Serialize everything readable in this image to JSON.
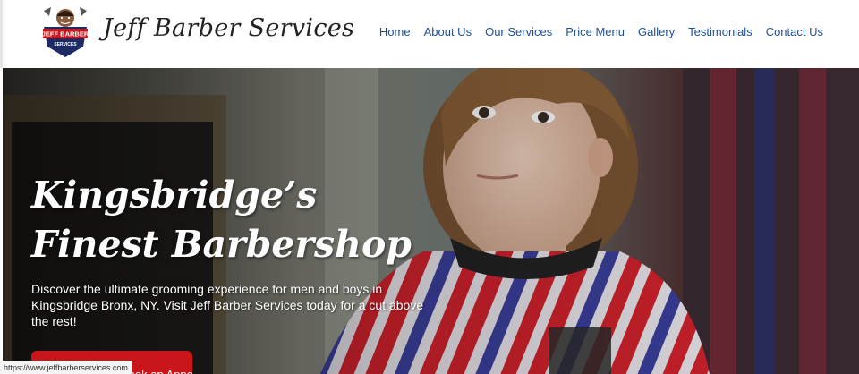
{
  "header": {
    "brand_name": "Jeff Barber Services",
    "logo": {
      "line1": "JEFF BARBER",
      "line2": "SERVICES",
      "icon": "barber-mascot-logo"
    },
    "nav": {
      "items": [
        {
          "label": "Home"
        },
        {
          "label": "About Us"
        },
        {
          "label": "Our Services"
        },
        {
          "label": "Price Menu"
        },
        {
          "label": "Gallery"
        },
        {
          "label": "Testimonials"
        },
        {
          "label": "Contact Us"
        }
      ]
    }
  },
  "hero": {
    "title": "Kingsbridge’s Finest Barbershop",
    "description": "Discover the ultimate grooming experience for men and boys in Kingsbridge Bronx, NY. Visit Jeff Barber Services today for a cut above the rest!",
    "cta_label": "Book an Appointment",
    "image": "boy-in-barber-cape-photo"
  },
  "status_bar": {
    "url": "https://www.jeffbarberservices.com"
  },
  "colors": {
    "nav_link": "#1f4f9b",
    "cta_background": "#c8161b",
    "logo_red": "#c8161b",
    "logo_navy": "#1d2a66",
    "cape_stripe_red": "#d2222c",
    "cape_stripe_blue": "#3b3f9c"
  }
}
